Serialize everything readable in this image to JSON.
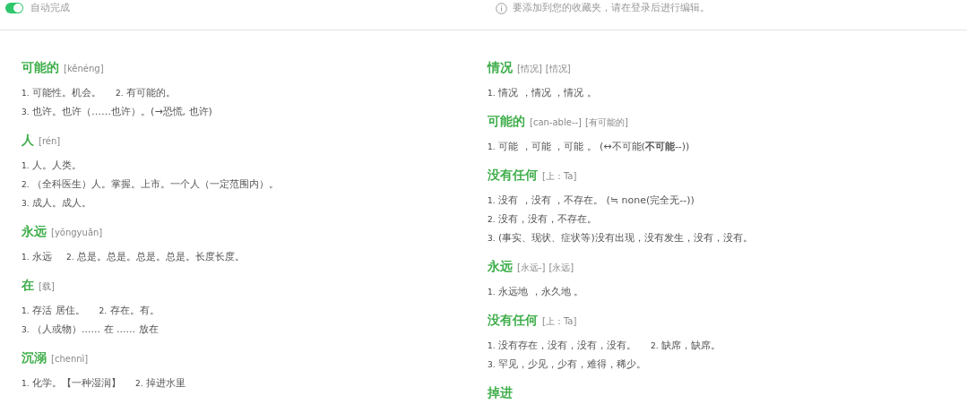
{
  "autocomplete": {
    "label": "自动完成",
    "on": true
  },
  "notice": "要添加到您的收藏夹，请在登录后进行编辑。",
  "columns": [
    {
      "entries": [
        {
          "word": "可能的",
          "tags": [
            "[kěnéng]"
          ],
          "lines": [
            [
              {
                "num": "1.",
                "text": "可能性。机会。"
              },
              {
                "num": "2.",
                "text": "有可能的。"
              }
            ],
            [
              {
                "num": "3.",
                "text": "也许。也许（……也许）。(→恐慌, 也许)"
              }
            ]
          ]
        },
        {
          "word": "人",
          "tags": [
            "[rén]"
          ],
          "lines": [
            [
              {
                "num": "1.",
                "text": "人。人类。"
              }
            ],
            [
              {
                "num": "2.",
                "text": "（全科医生）人。掌握。上市。一个人（一定范围内）。"
              }
            ],
            [
              {
                "num": "3.",
                "text": "成人。成人。"
              }
            ]
          ]
        },
        {
          "word": "永远",
          "tags": [
            "[yǒngyuǎn]"
          ],
          "lines": [
            [
              {
                "num": "1.",
                "text": "永远"
              },
              {
                "num": "2.",
                "text": "总是。总是。总是。总是。长度长度。"
              }
            ]
          ]
        },
        {
          "word": "在",
          "tags": [
            "[载]"
          ],
          "lines": [
            [
              {
                "num": "1.",
                "text": "存活 居住。"
              },
              {
                "num": "2.",
                "text": "存在。有。"
              }
            ],
            [
              {
                "num": "3.",
                "text": "（人或物）...... 在 ...... 放在"
              }
            ]
          ]
        },
        {
          "word": "沉溺",
          "tags": [
            "[chennì]"
          ],
          "lines": [
            [
              {
                "num": "1.",
                "text": "化学。【一种湿润】"
              },
              {
                "num": "2.",
                "text": "掉进水里"
              }
            ]
          ]
        }
      ]
    },
    {
      "entries": [
        {
          "word": "情况",
          "tags": [
            "[情况]",
            "[情况]"
          ],
          "lines": [
            [
              {
                "num": "1.",
                "text": "情况 ，情况 ，情况 。"
              }
            ]
          ]
        },
        {
          "word": "可能的",
          "tags": [
            "[can-able--]",
            "[有可能的]"
          ],
          "lines": [
            [
              {
                "num": "1.",
                "text": "可能 ，可能 ，可能 。 (↔不可能(**不可能**--))"
              }
            ]
          ]
        },
        {
          "word": "没有任何",
          "tags": [
            "[上：Ta]"
          ],
          "lines": [
            [
              {
                "num": "1.",
                "text": "没有 ，没有 ，不存在。 (≒ none(完全无--))"
              }
            ],
            [
              {
                "num": "2.",
                "text": "没有，没有，不存在。"
              }
            ],
            [
              {
                "num": "3.",
                "text": "(事实、现状、症状等)没有出现，没有发生，没有，没有。"
              }
            ]
          ]
        },
        {
          "word": "永远",
          "tags": [
            "[永远-]",
            "[永远]"
          ],
          "lines": [
            [
              {
                "num": "1.",
                "text": "永远地 ，永久地 。"
              }
            ]
          ]
        },
        {
          "word": "没有任何",
          "tags": [
            "[上：Ta]"
          ],
          "lines": [
            [
              {
                "num": "1.",
                "text": "没有存在，没有，没有，没有。"
              },
              {
                "num": "2.",
                "text": "缺席，缺席。"
              }
            ],
            [
              {
                "num": "3.",
                "text": "罕见，少见，少有，难得，稀少。"
              }
            ]
          ]
        },
        {
          "word": "掉进"
        }
      ]
    }
  ]
}
